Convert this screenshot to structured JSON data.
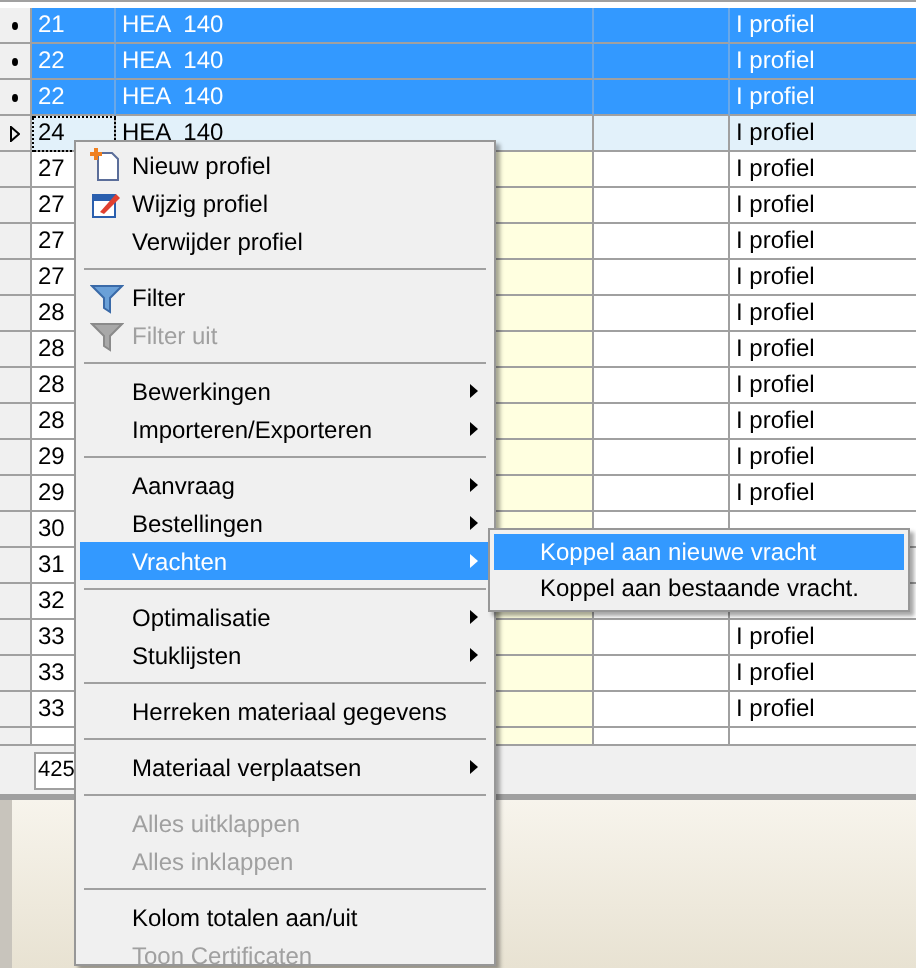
{
  "grid": {
    "rows": [
      {
        "selected": true,
        "current": false,
        "number": "21",
        "profile": "HEA  140",
        "type": "I profiel"
      },
      {
        "selected": true,
        "current": false,
        "number": "22",
        "profile": "HEA  140",
        "type": "I profiel"
      },
      {
        "selected": true,
        "current": false,
        "number": "22",
        "profile": "HEA  140",
        "type": "I profiel"
      },
      {
        "selected": false,
        "current": true,
        "number": "24",
        "profile": "HEA  140",
        "type": "I profiel"
      },
      {
        "selected": false,
        "current": false,
        "number": "27",
        "type": "I profiel"
      },
      {
        "selected": false,
        "current": false,
        "number": "27",
        "type": "I profiel"
      },
      {
        "selected": false,
        "current": false,
        "number": "27",
        "type": "I profiel"
      },
      {
        "selected": false,
        "current": false,
        "number": "27",
        "type": "I profiel"
      },
      {
        "selected": false,
        "current": false,
        "number": "28",
        "type": "I profiel"
      },
      {
        "selected": false,
        "current": false,
        "number": "28",
        "type": "I profiel"
      },
      {
        "selected": false,
        "current": false,
        "number": "28",
        "type": "I profiel"
      },
      {
        "selected": false,
        "current": false,
        "number": "28",
        "type": "I profiel"
      },
      {
        "selected": false,
        "current": false,
        "number": "29",
        "type": "I profiel"
      },
      {
        "selected": false,
        "current": false,
        "number": "29",
        "type": "I profiel"
      },
      {
        "selected": false,
        "current": false,
        "number": "30"
      },
      {
        "selected": false,
        "current": false,
        "number": "31"
      },
      {
        "selected": false,
        "current": false,
        "number": "32"
      },
      {
        "selected": false,
        "current": false,
        "number": "33",
        "type": "I profiel"
      },
      {
        "selected": false,
        "current": false,
        "number": "33",
        "type": "I profiel"
      },
      {
        "selected": false,
        "current": false,
        "number": "33",
        "type": "I profiel"
      }
    ],
    "footer_total": "425"
  },
  "context_menu": {
    "items": [
      {
        "kind": "item",
        "label": "Nieuw profiel",
        "disabled": false,
        "submenu": false,
        "selected": false
      },
      {
        "kind": "item",
        "label": "Wijzig profiel",
        "disabled": false,
        "submenu": false,
        "selected": false
      },
      {
        "kind": "item",
        "label": "Verwijder profiel",
        "disabled": false,
        "submenu": false,
        "selected": false
      },
      {
        "kind": "separator"
      },
      {
        "kind": "item",
        "label": "Filter",
        "disabled": false,
        "submenu": false,
        "selected": false
      },
      {
        "kind": "item",
        "label": "Filter uit",
        "disabled": true,
        "submenu": false,
        "selected": false
      },
      {
        "kind": "separator"
      },
      {
        "kind": "item",
        "label": "Bewerkingen",
        "disabled": false,
        "submenu": true,
        "selected": false
      },
      {
        "kind": "item",
        "label": "Importeren/Exporteren",
        "disabled": false,
        "submenu": true,
        "selected": false
      },
      {
        "kind": "separator"
      },
      {
        "kind": "item",
        "label": "Aanvraag",
        "disabled": false,
        "submenu": true,
        "selected": false
      },
      {
        "kind": "item",
        "label": "Bestellingen",
        "disabled": false,
        "submenu": true,
        "selected": false
      },
      {
        "kind": "item",
        "label": "Vrachten",
        "disabled": false,
        "submenu": true,
        "selected": true
      },
      {
        "kind": "separator"
      },
      {
        "kind": "item",
        "label": "Optimalisatie",
        "disabled": false,
        "submenu": true,
        "selected": false
      },
      {
        "kind": "item",
        "label": "Stuklijsten",
        "disabled": false,
        "submenu": true,
        "selected": false
      },
      {
        "kind": "separator"
      },
      {
        "kind": "item",
        "label": "Herreken materiaal gegevens",
        "disabled": false,
        "submenu": false,
        "selected": false
      },
      {
        "kind": "separator"
      },
      {
        "kind": "item",
        "label": "Materiaal verplaatsen",
        "disabled": false,
        "submenu": true,
        "selected": false
      },
      {
        "kind": "separator"
      },
      {
        "kind": "item",
        "label": "Alles uitklappen",
        "disabled": true,
        "submenu": false,
        "selected": false
      },
      {
        "kind": "item",
        "label": "Alles inklappen",
        "disabled": true,
        "submenu": false,
        "selected": false
      },
      {
        "kind": "separator"
      },
      {
        "kind": "item",
        "label": "Kolom totalen aan/uit",
        "disabled": false,
        "submenu": false,
        "selected": false
      },
      {
        "kind": "item",
        "label": "Toon Certificaten",
        "disabled": true,
        "submenu": false,
        "selected": false
      }
    ]
  },
  "submenu": {
    "items": [
      {
        "label": "Koppel aan nieuwe vracht",
        "selected": true
      },
      {
        "label": "Koppel aan bestaande vracht.",
        "selected": false
      }
    ]
  }
}
